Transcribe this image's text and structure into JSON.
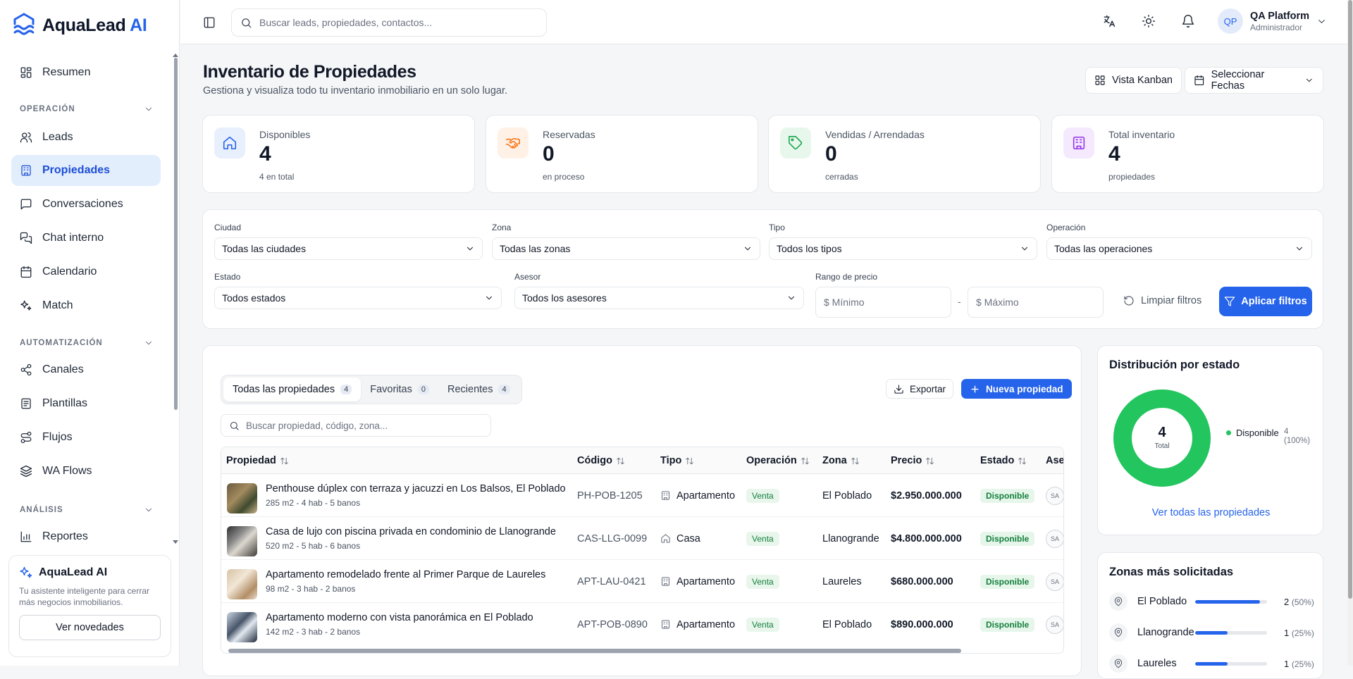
{
  "brand": {
    "name": "AquaLead",
    "accent": "AI"
  },
  "colors": {
    "primary": "#2563eb",
    "success": "#22c55e",
    "warning": "#f97316",
    "purple": "#9333ea"
  },
  "sidebar": {
    "items": [
      {
        "label": "Resumen",
        "icon": "grid-icon"
      },
      {
        "label": "Leads",
        "icon": "users-icon"
      },
      {
        "label": "Propiedades",
        "icon": "building-icon",
        "active": true
      },
      {
        "label": "Conversaciones",
        "icon": "message-icon"
      },
      {
        "label": "Chat interno",
        "icon": "chat-icon"
      },
      {
        "label": "Calendario",
        "icon": "calendar-icon"
      },
      {
        "label": "Match",
        "icon": "sparkles-icon"
      },
      {
        "label": "Canales",
        "icon": "share-icon"
      },
      {
        "label": "Plantillas",
        "icon": "file-icon"
      },
      {
        "label": "Flujos",
        "icon": "flow-icon"
      },
      {
        "label": "WA Flows",
        "icon": "layers-icon"
      },
      {
        "label": "Reportes",
        "icon": "bar-chart-icon"
      }
    ],
    "sections": [
      "OPERACIÓN",
      "AUTOMATIZACIÓN",
      "ANÁLISIS"
    ],
    "promo": {
      "title": "AquaLead AI",
      "desc": "Tu asistente inteligente para cerrar más negocios inmobiliarios.",
      "button": "Ver novedades"
    }
  },
  "header": {
    "search_placeholder": "Buscar leads, propiedades, contactos...",
    "user": {
      "initials": "QP",
      "name": "QA Platform",
      "role": "Administrador"
    }
  },
  "page": {
    "title": "Inventario de Propiedades",
    "subtitle": "Gestiona y visualiza todo tu inventario inmobiliario en un solo lugar.",
    "kanban_button": "Vista Kanban",
    "dates_button": "Seleccionar Fechas"
  },
  "stats": [
    {
      "label": "Disponibles",
      "value": "4",
      "sub": "4 en total"
    },
    {
      "label": "Reservadas",
      "value": "0",
      "sub": "en proceso"
    },
    {
      "label": "Vendidas / Arrendadas",
      "value": "0",
      "sub": "cerradas"
    },
    {
      "label": "Total inventario",
      "value": "4",
      "sub": "propiedades"
    }
  ],
  "filters": {
    "ciudad": {
      "label": "Ciudad",
      "value": "Todas las ciudades"
    },
    "zona": {
      "label": "Zona",
      "value": "Todas las zonas"
    },
    "tipo": {
      "label": "Tipo",
      "value": "Todos los tipos"
    },
    "operacion": {
      "label": "Operación",
      "value": "Todas las operaciones"
    },
    "estado": {
      "label": "Estado",
      "value": "Todos estados"
    },
    "asesor": {
      "label": "Asesor",
      "value": "Todos los asesores"
    },
    "precio": {
      "label": "Rango de precio",
      "min_placeholder": "$ Mínimo",
      "max_placeholder": "$ Máximo",
      "separator": "-"
    },
    "clear": "Limpiar filtros",
    "apply": "Aplicar filtros"
  },
  "table": {
    "tabs": [
      {
        "label": "Todas las propiedades",
        "count": "4"
      },
      {
        "label": "Favoritas",
        "count": "0"
      },
      {
        "label": "Recientes",
        "count": "4"
      }
    ],
    "export": "Exportar",
    "new": "Nueva propiedad",
    "search_placeholder": "Buscar propiedad, código, zona...",
    "columns": [
      "Propiedad",
      "Código",
      "Tipo",
      "Operación",
      "Zona",
      "Precio",
      "Estado",
      "Ase"
    ],
    "rows": [
      {
        "name": "Penthouse dúplex con terraza y jacuzzi en Los Balsos, El Poblado",
        "details": "285 m2 - 4 hab - 5 banos",
        "code": "PH-POB-1205",
        "type": "Apartamento",
        "op": "Venta",
        "zone": "El Poblado",
        "price": "$2.950.000.000",
        "status": "Disponible",
        "agent": "SA"
      },
      {
        "name": "Casa de lujo con piscina privada en condominio de Llanogrande",
        "details": "520 m2 - 5 hab - 6 banos",
        "code": "CAS-LLG-0099",
        "type": "Casa",
        "op": "Venta",
        "zone": "Llanogrande",
        "price": "$4.800.000.000",
        "status": "Disponible",
        "agent": "SA"
      },
      {
        "name": "Apartamento remodelado frente al Primer Parque de Laureles",
        "details": "98 m2 - 3 hab - 2 banos",
        "code": "APT-LAU-0421",
        "type": "Apartamento",
        "op": "Venta",
        "zone": "Laureles",
        "price": "$680.000.000",
        "status": "Disponible",
        "agent": "SA"
      },
      {
        "name": "Apartamento moderno con vista panorámica en El Poblado",
        "details": "142 m2 - 3 hab - 2 banos",
        "code": "APT-POB-0890",
        "type": "Apartamento",
        "op": "Venta",
        "zone": "El Poblado",
        "price": "$890.000.000",
        "status": "Disponible",
        "agent": "SA"
      }
    ]
  },
  "distribution": {
    "title": "Distribución por estado",
    "total": "4",
    "total_label": "Total",
    "legend": {
      "label": "Disponible",
      "value": "4",
      "pct": "(100%)"
    },
    "link": "Ver todas las propiedades",
    "chart_data": {
      "type": "pie",
      "categories": [
        "Disponible"
      ],
      "values": [
        4
      ]
    }
  },
  "zones": {
    "title": "Zonas más solicitadas",
    "items": [
      {
        "name": "El Poblado",
        "count": "2",
        "pct": "(50%)",
        "fraction": 0.5
      },
      {
        "name": "Llanogrande",
        "count": "1",
        "pct": "(25%)",
        "fraction": 0.25
      },
      {
        "name": "Laureles",
        "count": "1",
        "pct": "(25%)",
        "fraction": 0.25
      }
    ]
  }
}
